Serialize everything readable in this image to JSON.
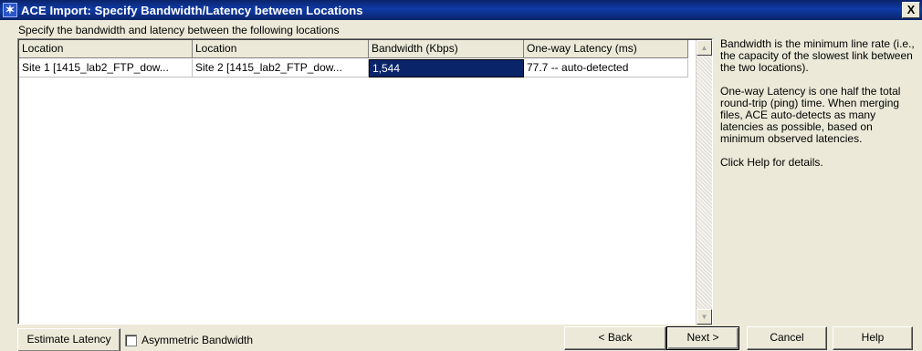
{
  "window": {
    "title": "ACE Import: Specify Bandwidth/Latency between Locations",
    "close_label": "X"
  },
  "instructions": "Specify the bandwidth and latency between the following locations",
  "table": {
    "columns": [
      "Location",
      "Location",
      "Bandwidth (Kbps)",
      "One-way Latency (ms)"
    ],
    "rows": [
      {
        "location_a": "Site 1 [1415_lab2_FTP_dow...",
        "location_b": "Site 2 [1415_lab2_FTP_dow...",
        "bandwidth": "1,544",
        "latency": "77.7 -- auto-detected"
      }
    ]
  },
  "help": {
    "paragraph1": "Bandwidth is the minimum line rate (i.e., the capacity of the slowest link between the two locations).",
    "paragraph2": "One-way Latency is one half the total round-trip (ping) time. When merging files, ACE auto-detects as many latencies as possible, based on minimum observed latencies.",
    "paragraph3": "Click Help for details."
  },
  "buttons": {
    "estimate": "Estimate Latency",
    "back": "< Back",
    "next": "Next >",
    "cancel": "Cancel",
    "help": "Help"
  },
  "checkbox": {
    "label": "Asymmetric Bandwidth",
    "checked": false
  }
}
